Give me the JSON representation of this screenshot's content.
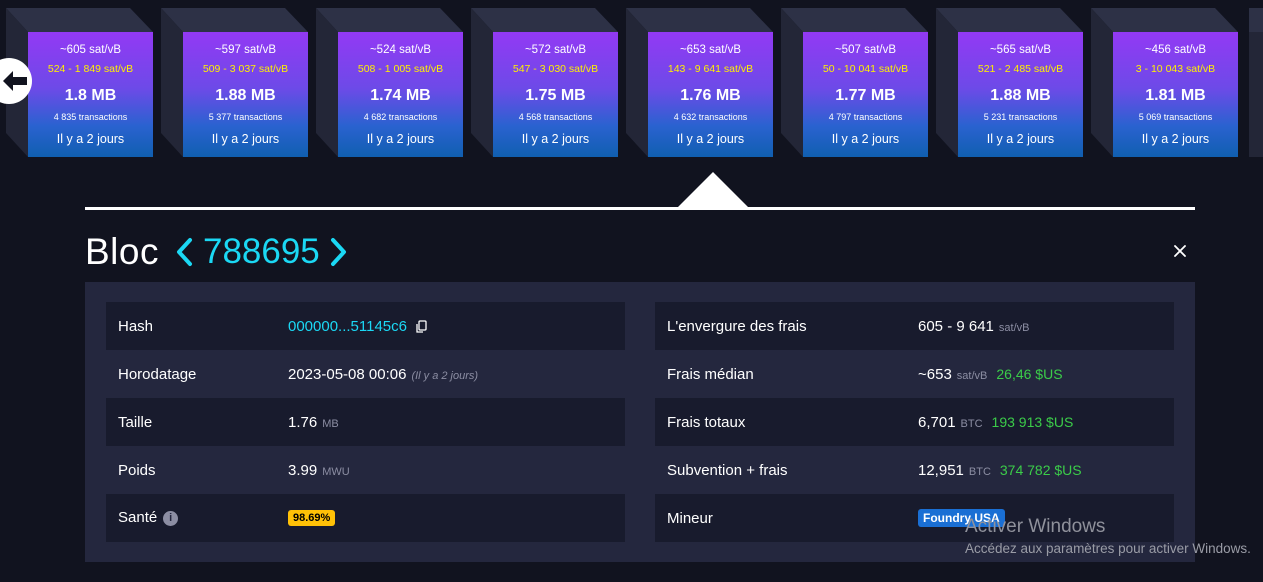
{
  "blocks": [
    {
      "fee_median": "~605 sat/vB",
      "fee_range": "524 - 1 849 sat/vB",
      "size": "1.8 MB",
      "tx": "4 835 transactions",
      "time": "Il y a 2 jours"
    },
    {
      "fee_median": "~597 sat/vB",
      "fee_range": "509 - 3 037 sat/vB",
      "size": "1.88 MB",
      "tx": "5 377 transactions",
      "time": "Il y a 2 jours"
    },
    {
      "fee_median": "~524 sat/vB",
      "fee_range": "508 - 1 005 sat/vB",
      "size": "1.74 MB",
      "tx": "4 682 transactions",
      "time": "Il y a 2 jours"
    },
    {
      "fee_median": "~572 sat/vB",
      "fee_range": "547 - 3 030 sat/vB",
      "size": "1.75 MB",
      "tx": "4 568 transactions",
      "time": "Il y a 2 jours"
    },
    {
      "fee_median": "~653 sat/vB",
      "fee_range": "143 - 9 641 sat/vB",
      "size": "1.76 MB",
      "tx": "4 632 transactions",
      "time": "Il y a 2 jours"
    },
    {
      "fee_median": "~507 sat/vB",
      "fee_range": "50 - 10 041 sat/vB",
      "size": "1.77 MB",
      "tx": "4 797 transactions",
      "time": "Il y a 2 jours"
    },
    {
      "fee_median": "~565 sat/vB",
      "fee_range": "521 - 2 485 sat/vB",
      "size": "1.88 MB",
      "tx": "5 231 transactions",
      "time": "Il y a 2 jours"
    },
    {
      "fee_median": "~456 sat/vB",
      "fee_range": "3 - 10 043 sat/vB",
      "size": "1.81 MB",
      "tx": "5 069 transactions",
      "time": "Il y a 2 jours"
    }
  ],
  "nav": {
    "back_icon": "arrow-left-icon"
  },
  "title": {
    "word": "Bloc",
    "height": "788695",
    "prev_icon": "chevron-left-icon",
    "next_icon": "chevron-right-icon",
    "close_icon": "close-icon"
  },
  "details_left": {
    "hash": {
      "label": "Hash",
      "value": "000000...51145c6"
    },
    "timestamp": {
      "label": "Horodatage",
      "value": "2023-05-08 00:06",
      "ago": "(Il y a 2 jours)"
    },
    "size": {
      "label": "Taille",
      "value": "1.76",
      "unit": "MB"
    },
    "weight": {
      "label": "Poids",
      "value": "3.99",
      "unit": "MWU"
    },
    "health": {
      "label": "Santé",
      "value": "98.69%",
      "info_icon": "i"
    }
  },
  "details_right": {
    "fee_span": {
      "label": "L'envergure des frais",
      "value": "605 - 9 641",
      "unit": "sat/vB"
    },
    "median_fee": {
      "label": "Frais médian",
      "value": "~653",
      "unit": "sat/vB",
      "usd": "26,46 $US"
    },
    "total_fees": {
      "label": "Frais totaux",
      "value": "6,701",
      "unit": "BTC",
      "usd": "193 913 $US"
    },
    "subsidy_fees": {
      "label": "Subvention + frais",
      "value": "12,951",
      "unit": "BTC",
      "usd": "374 782 $US"
    },
    "miner": {
      "label": "Mineur",
      "value": "Foundry USA"
    }
  },
  "watermark": {
    "title": "Activer Windows",
    "subtitle": "Accédez aux paramètres pour activer Windows."
  },
  "colors": {
    "accent": "#1bd8f4",
    "usd_green": "#3bcc49",
    "health_badge": "#ffc107",
    "miner_badge": "#1a6fd4",
    "fee_range": "#fff000"
  }
}
